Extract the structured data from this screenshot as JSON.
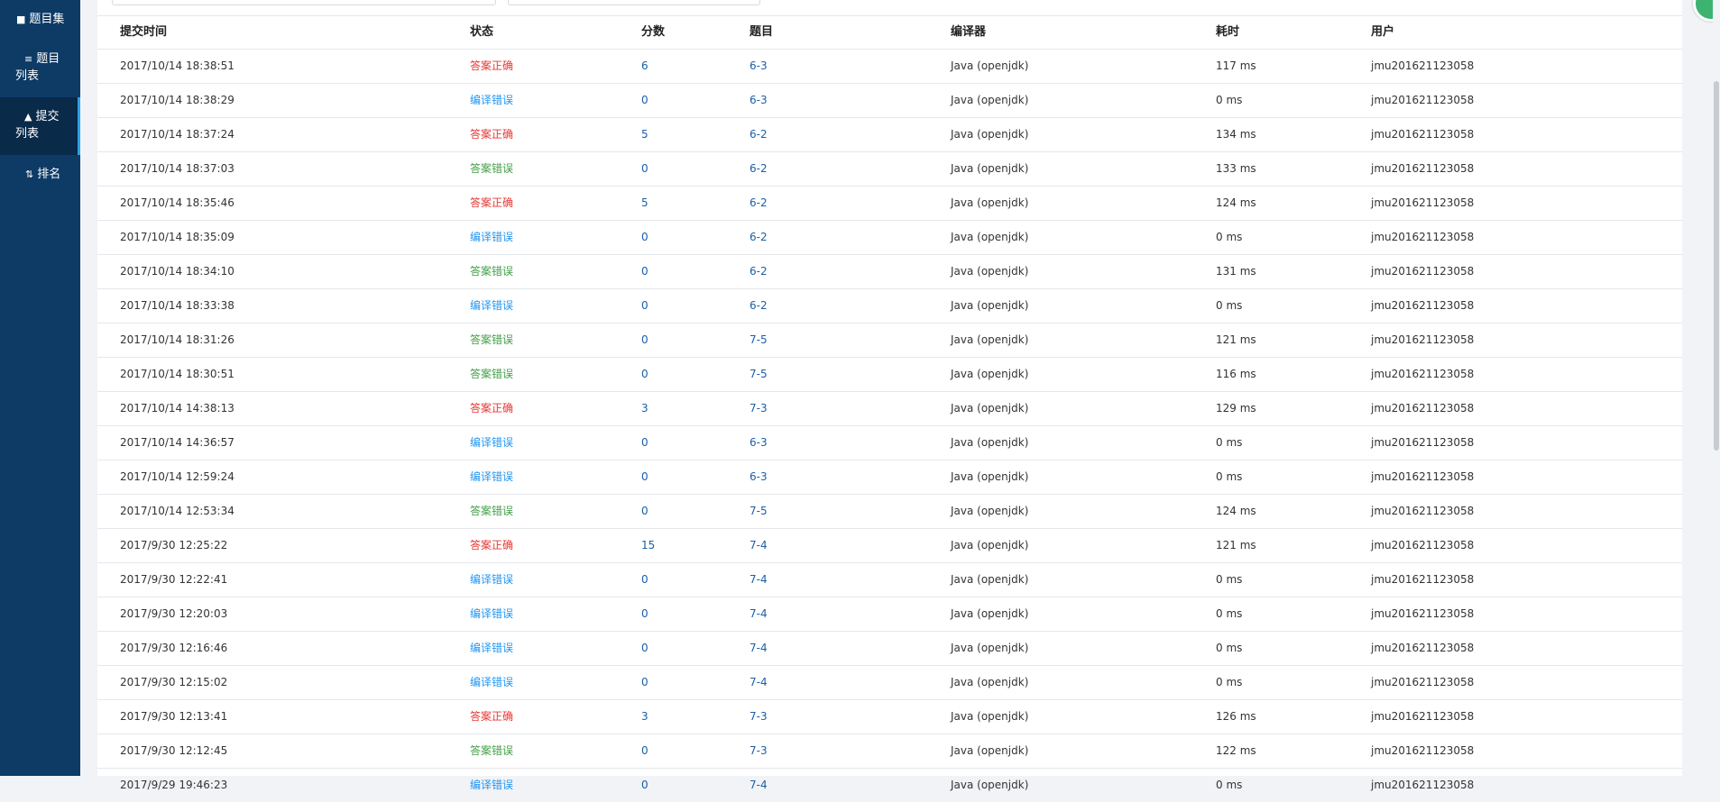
{
  "sidebar": {
    "items": [
      {
        "icon": "book-icon",
        "glyph": "■",
        "label": "题目集"
      },
      {
        "icon": "list-icon",
        "glyph": "≡",
        "label": "题目列表"
      },
      {
        "icon": "upload-icon",
        "glyph": "▲",
        "label": "提交列表",
        "active": true
      },
      {
        "icon": "sort-icon",
        "glyph": "⇅",
        "label": "排名"
      }
    ]
  },
  "table": {
    "headers": [
      "提交时间",
      "状态",
      "分数",
      "题目",
      "编译器",
      "耗时",
      "用户"
    ],
    "rows": [
      [
        "2017/10/14 18:38:51",
        "答案正确",
        "6",
        "6-3",
        "Java (openjdk)",
        "117 ms",
        "jmu201621123058"
      ],
      [
        "2017/10/14 18:38:29",
        "编译错误",
        "0",
        "6-3",
        "Java (openjdk)",
        "0 ms",
        "jmu201621123058"
      ],
      [
        "2017/10/14 18:37:24",
        "答案正确",
        "5",
        "6-2",
        "Java (openjdk)",
        "134 ms",
        "jmu201621123058"
      ],
      [
        "2017/10/14 18:37:03",
        "答案错误",
        "0",
        "6-2",
        "Java (openjdk)",
        "133 ms",
        "jmu201621123058"
      ],
      [
        "2017/10/14 18:35:46",
        "答案正确",
        "5",
        "6-2",
        "Java (openjdk)",
        "124 ms",
        "jmu201621123058"
      ],
      [
        "2017/10/14 18:35:09",
        "编译错误",
        "0",
        "6-2",
        "Java (openjdk)",
        "0 ms",
        "jmu201621123058"
      ],
      [
        "2017/10/14 18:34:10",
        "答案错误",
        "0",
        "6-2",
        "Java (openjdk)",
        "131 ms",
        "jmu201621123058"
      ],
      [
        "2017/10/14 18:33:38",
        "编译错误",
        "0",
        "6-2",
        "Java (openjdk)",
        "0 ms",
        "jmu201621123058"
      ],
      [
        "2017/10/14 18:31:26",
        "答案错误",
        "0",
        "7-5",
        "Java (openjdk)",
        "121 ms",
        "jmu201621123058"
      ],
      [
        "2017/10/14 18:30:51",
        "答案错误",
        "0",
        "7-5",
        "Java (openjdk)",
        "116 ms",
        "jmu201621123058"
      ],
      [
        "2017/10/14 14:38:13",
        "答案正确",
        "3",
        "7-3",
        "Java (openjdk)",
        "129 ms",
        "jmu201621123058"
      ],
      [
        "2017/10/14 14:36:57",
        "编译错误",
        "0",
        "6-3",
        "Java (openjdk)",
        "0 ms",
        "jmu201621123058"
      ],
      [
        "2017/10/14 12:59:24",
        "编译错误",
        "0",
        "6-3",
        "Java (openjdk)",
        "0 ms",
        "jmu201621123058"
      ],
      [
        "2017/10/14 12:53:34",
        "答案错误",
        "0",
        "7-5",
        "Java (openjdk)",
        "124 ms",
        "jmu201621123058"
      ],
      [
        "2017/9/30 12:25:22",
        "答案正确",
        "15",
        "7-4",
        "Java (openjdk)",
        "121 ms",
        "jmu201621123058"
      ],
      [
        "2017/9/30 12:22:41",
        "编译错误",
        "0",
        "7-4",
        "Java (openjdk)",
        "0 ms",
        "jmu201621123058"
      ],
      [
        "2017/9/30 12:20:03",
        "编译错误",
        "0",
        "7-4",
        "Java (openjdk)",
        "0 ms",
        "jmu201621123058"
      ],
      [
        "2017/9/30 12:16:46",
        "编译错误",
        "0",
        "7-4",
        "Java (openjdk)",
        "0 ms",
        "jmu201621123058"
      ],
      [
        "2017/9/30 12:15:02",
        "编译错误",
        "0",
        "7-4",
        "Java (openjdk)",
        "0 ms",
        "jmu201621123058"
      ],
      [
        "2017/9/30 12:13:41",
        "答案正确",
        "3",
        "7-3",
        "Java (openjdk)",
        "126 ms",
        "jmu201621123058"
      ],
      [
        "2017/9/30 12:12:45",
        "答案错误",
        "0",
        "7-3",
        "Java (openjdk)",
        "122 ms",
        "jmu201621123058"
      ],
      [
        "2017/9/29 19:46:23",
        "编译错误",
        "0",
        "7-4",
        "Java (openjdk)",
        "0 ms",
        "jmu201621123058"
      ]
    ]
  },
  "status_colors": {
    "答案正确": "#e53935",
    "编译错误": "#2196f3",
    "答案错误": "#43a047"
  },
  "colors": {
    "sidebar_bg": "#0d3b66",
    "sidebar_active_bg": "#0a2a4a",
    "sidebar_active_accent": "#2fa3e6",
    "link": "#1a5fa8"
  }
}
